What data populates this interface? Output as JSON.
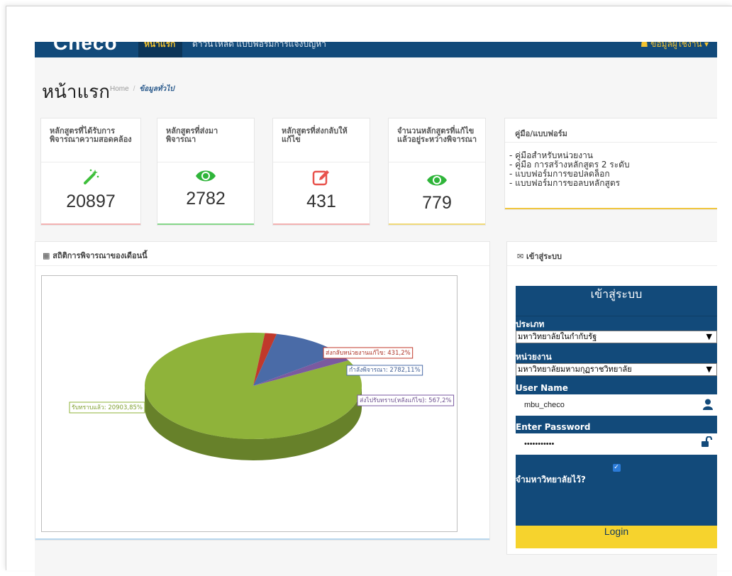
{
  "nav": {
    "brand": "Checo",
    "active": "หน้าแรก",
    "link": "ดาวน์โหลด แบบฟอร์มการแจ้งปัญหา",
    "user": "ข้อมูลผู้ใช้งาน"
  },
  "page": {
    "title": "หน้าแรก",
    "breadcrumb": {
      "home": "Home",
      "sep": "/",
      "current": "ข้อมูลทั่วไป"
    }
  },
  "cards": [
    {
      "label": "หลักสูตรที่ได้รับการพิจารณาความสอดคล้อง",
      "value": "20897",
      "icon": "magic-wand-icon",
      "color": "#3ebf3b",
      "bar": "#f3b2b2"
    },
    {
      "label": "หลักสูตรที่ส่งมาพิจารณา",
      "value": "2782",
      "icon": "eye-icon",
      "color": "#2fb53a",
      "bar": "#86d78a"
    },
    {
      "label": "หลักสูตรที่ส่งกลับให้แก้ไข",
      "value": "431",
      "icon": "edit-icon",
      "color": "#e8524c",
      "bar": "#f3b2b2"
    },
    {
      "label": "จำนวนหลักสูตรที่แก้ไขแล้วอยู่ระหว่างพิจารณา",
      "value": "779",
      "icon": "eye-icon",
      "color": "#2fb53a",
      "bar": "#f1da78"
    }
  ],
  "manual": {
    "title": "คู่มือ/แบบฟอร์ม",
    "items": [
      "- คู่มือสำหรับหน่วยงาน",
      "- คู่มือ การสร้างหลักสูตร 2 ระดับ",
      "- แบบฟอร์มการขอปลดล็อก",
      "- แบบฟอร์มการขอลบหลักสูตร"
    ]
  },
  "stats_panel": {
    "title": "สถิติการพิจารณาของเดือนนี้",
    "icon": "calendar-icon"
  },
  "chart_data": {
    "type": "pie",
    "slices": [
      {
        "label": "รับทราบแล้ว",
        "value": 20903,
        "percent": 85,
        "color": "#8fb33a",
        "text": "รับทราบแล้ว: 20903,85%"
      },
      {
        "label": "ส่งกลับหน่วยงานแก้ไข",
        "value": 431,
        "percent": 2,
        "color": "#c0392b",
        "text": "ส่งกลับหน่วยงานแก้ไข: 431,2%"
      },
      {
        "label": "กำลังพิจารณา",
        "value": 2782,
        "percent": 11,
        "color": "#4a6ba7",
        "text": "กำลังพิจารณา: 2782,11%"
      },
      {
        "label": "ส่งไปรับทราบ(หลังแก้ไข)",
        "value": 567,
        "percent": 2,
        "color": "#7a5aa0",
        "text": "ส่งไปรับทราบ(หลังแก้ไข): 567,2%"
      }
    ]
  },
  "login_panel": {
    "header": "เข้าสู่ระบบ",
    "title": "เข้าสู่ระบบ",
    "type_label": "ประเภท",
    "type_value": "มหาวิทยาลัยในกำกับรัฐ",
    "unit_label": "หน่วยงาน",
    "unit_value": "มหาวิทยาลัยมหามกุฏราชวิทยาลัย",
    "username_label": "User Name",
    "username_value": "mbu_checo",
    "password_label": "Enter Password",
    "password_value": "•••••••••••",
    "remember_label": "จำมหาวิทยาลัยไว้?",
    "login_button": "Login"
  }
}
